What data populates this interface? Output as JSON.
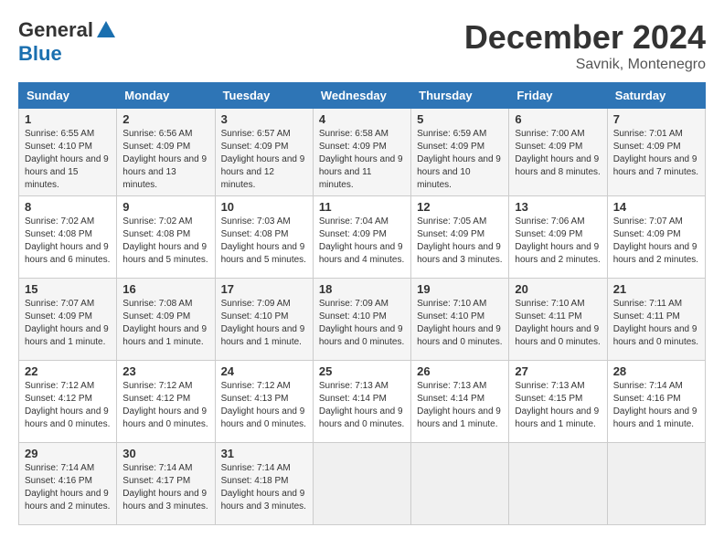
{
  "header": {
    "logo_general": "General",
    "logo_blue": "Blue",
    "month": "December 2024",
    "location": "Savnik, Montenegro"
  },
  "weekdays": [
    "Sunday",
    "Monday",
    "Tuesday",
    "Wednesday",
    "Thursday",
    "Friday",
    "Saturday"
  ],
  "weeks": [
    [
      {
        "day": "1",
        "sunrise": "6:55 AM",
        "sunset": "4:10 PM",
        "daylight": "9 hours and 15 minutes."
      },
      {
        "day": "2",
        "sunrise": "6:56 AM",
        "sunset": "4:09 PM",
        "daylight": "9 hours and 13 minutes."
      },
      {
        "day": "3",
        "sunrise": "6:57 AM",
        "sunset": "4:09 PM",
        "daylight": "9 hours and 12 minutes."
      },
      {
        "day": "4",
        "sunrise": "6:58 AM",
        "sunset": "4:09 PM",
        "daylight": "9 hours and 11 minutes."
      },
      {
        "day": "5",
        "sunrise": "6:59 AM",
        "sunset": "4:09 PM",
        "daylight": "9 hours and 10 minutes."
      },
      {
        "day": "6",
        "sunrise": "7:00 AM",
        "sunset": "4:09 PM",
        "daylight": "9 hours and 8 minutes."
      },
      {
        "day": "7",
        "sunrise": "7:01 AM",
        "sunset": "4:09 PM",
        "daylight": "9 hours and 7 minutes."
      }
    ],
    [
      {
        "day": "8",
        "sunrise": "7:02 AM",
        "sunset": "4:08 PM",
        "daylight": "9 hours and 6 minutes."
      },
      {
        "day": "9",
        "sunrise": "7:02 AM",
        "sunset": "4:08 PM",
        "daylight": "9 hours and 5 minutes."
      },
      {
        "day": "10",
        "sunrise": "7:03 AM",
        "sunset": "4:08 PM",
        "daylight": "9 hours and 5 minutes."
      },
      {
        "day": "11",
        "sunrise": "7:04 AM",
        "sunset": "4:09 PM",
        "daylight": "9 hours and 4 minutes."
      },
      {
        "day": "12",
        "sunrise": "7:05 AM",
        "sunset": "4:09 PM",
        "daylight": "9 hours and 3 minutes."
      },
      {
        "day": "13",
        "sunrise": "7:06 AM",
        "sunset": "4:09 PM",
        "daylight": "9 hours and 2 minutes."
      },
      {
        "day": "14",
        "sunrise": "7:07 AM",
        "sunset": "4:09 PM",
        "daylight": "9 hours and 2 minutes."
      }
    ],
    [
      {
        "day": "15",
        "sunrise": "7:07 AM",
        "sunset": "4:09 PM",
        "daylight": "9 hours and 1 minute."
      },
      {
        "day": "16",
        "sunrise": "7:08 AM",
        "sunset": "4:09 PM",
        "daylight": "9 hours and 1 minute."
      },
      {
        "day": "17",
        "sunrise": "7:09 AM",
        "sunset": "4:10 PM",
        "daylight": "9 hours and 1 minute."
      },
      {
        "day": "18",
        "sunrise": "7:09 AM",
        "sunset": "4:10 PM",
        "daylight": "9 hours and 0 minutes."
      },
      {
        "day": "19",
        "sunrise": "7:10 AM",
        "sunset": "4:10 PM",
        "daylight": "9 hours and 0 minutes."
      },
      {
        "day": "20",
        "sunrise": "7:10 AM",
        "sunset": "4:11 PM",
        "daylight": "9 hours and 0 minutes."
      },
      {
        "day": "21",
        "sunrise": "7:11 AM",
        "sunset": "4:11 PM",
        "daylight": "9 hours and 0 minutes."
      }
    ],
    [
      {
        "day": "22",
        "sunrise": "7:12 AM",
        "sunset": "4:12 PM",
        "daylight": "9 hours and 0 minutes."
      },
      {
        "day": "23",
        "sunrise": "7:12 AM",
        "sunset": "4:12 PM",
        "daylight": "9 hours and 0 minutes."
      },
      {
        "day": "24",
        "sunrise": "7:12 AM",
        "sunset": "4:13 PM",
        "daylight": "9 hours and 0 minutes."
      },
      {
        "day": "25",
        "sunrise": "7:13 AM",
        "sunset": "4:14 PM",
        "daylight": "9 hours and 0 minutes."
      },
      {
        "day": "26",
        "sunrise": "7:13 AM",
        "sunset": "4:14 PM",
        "daylight": "9 hours and 1 minute."
      },
      {
        "day": "27",
        "sunrise": "7:13 AM",
        "sunset": "4:15 PM",
        "daylight": "9 hours and 1 minute."
      },
      {
        "day": "28",
        "sunrise": "7:14 AM",
        "sunset": "4:16 PM",
        "daylight": "9 hours and 1 minute."
      }
    ],
    [
      {
        "day": "29",
        "sunrise": "7:14 AM",
        "sunset": "4:16 PM",
        "daylight": "9 hours and 2 minutes."
      },
      {
        "day": "30",
        "sunrise": "7:14 AM",
        "sunset": "4:17 PM",
        "daylight": "9 hours and 3 minutes."
      },
      {
        "day": "31",
        "sunrise": "7:14 AM",
        "sunset": "4:18 PM",
        "daylight": "9 hours and 3 minutes."
      },
      null,
      null,
      null,
      null
    ]
  ]
}
